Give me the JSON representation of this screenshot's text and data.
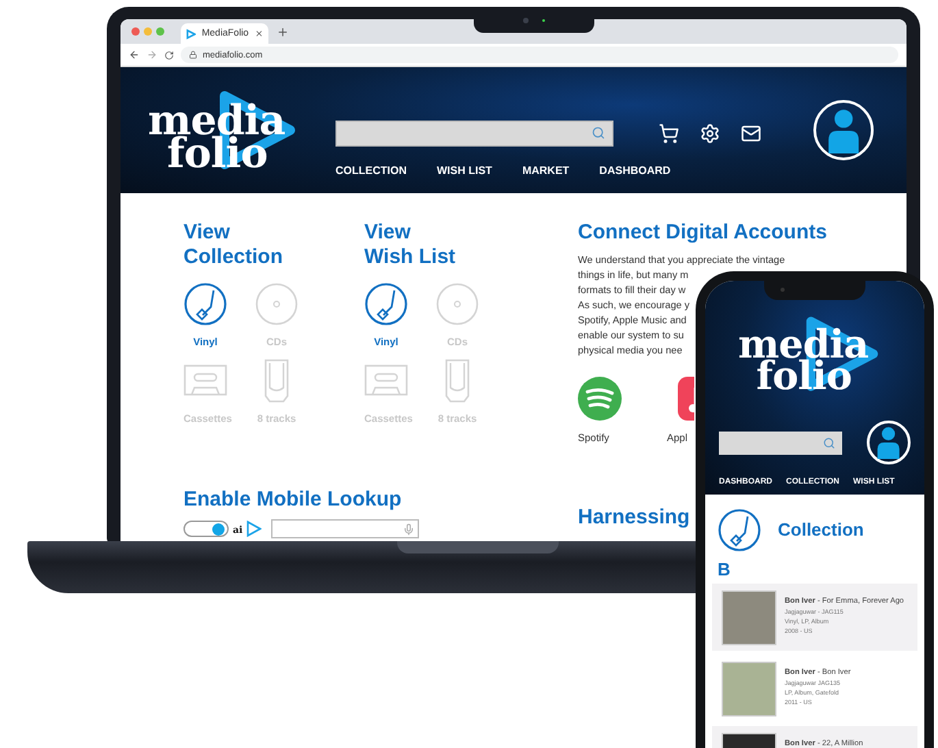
{
  "laptop": {
    "browser": {
      "tab_title": "MediaFolio",
      "url": "mediafolio.com"
    },
    "header": {
      "logo": {
        "line1": "media",
        "line2": "folio"
      },
      "nav": [
        "COLLECTION",
        "WISH LIST",
        "MARKET",
        "DASHBOARD"
      ]
    },
    "sections": [
      {
        "title_lines": [
          "View",
          "Collection"
        ],
        "formats": [
          {
            "label": "Vinyl",
            "kind": "vinyl",
            "selected": true
          },
          {
            "label": "CDs",
            "kind": "cd",
            "selected": false
          },
          {
            "label": "Cassettes",
            "kind": "cassette",
            "selected": false
          },
          {
            "label": "8 tracks",
            "kind": "eight-track",
            "selected": false
          }
        ]
      },
      {
        "title_lines": [
          "View",
          "Wish List"
        ],
        "formats": [
          {
            "label": "Vinyl",
            "kind": "vinyl",
            "selected": true
          },
          {
            "label": "CDs",
            "kind": "cd",
            "selected": false
          },
          {
            "label": "Cassettes",
            "kind": "cassette",
            "selected": false
          },
          {
            "label": "8 tracks",
            "kind": "eight-track",
            "selected": false
          }
        ]
      }
    ],
    "mobile_lookup": {
      "title": "Enable Mobile Lookup",
      "on": true,
      "ai_label": "ai"
    },
    "connect": {
      "title": "Connect Digital Accounts",
      "paragraph_lines": [
        "We understand that you appreciate the vintage",
        "things in life, but many m",
        "formats to fill their day w",
        "As such, we encourage y",
        "Spotify, Apple Music and",
        "enable our system to su",
        "physical media you nee"
      ],
      "services": [
        {
          "label": "Spotify",
          "kind": "spotify"
        },
        {
          "label": "Appl",
          "kind": "apple"
        }
      ]
    },
    "harnessing_title": "Harnessing"
  },
  "phone": {
    "header": {
      "logo": {
        "line1": "media",
        "line2": "folio"
      },
      "nav": [
        "DASHBOARD",
        "COLLECTION",
        "WISH LIST"
      ]
    },
    "collection_title": "Collection",
    "letter": "B",
    "records": [
      {
        "line": "**Bon Iver** - For Emma, Forever Ago",
        "details": [
          "Jagjaguwar - JAG115",
          "Vinyl, LP, Album",
          "2008 - US"
        ],
        "shaded": true
      },
      {
        "line": "**Bon Iver** - Bon Iver",
        "details": [
          "Jagjaguwar JAG135",
          "LP, Album, Gatefold",
          "2011 - US"
        ],
        "shaded": false
      },
      {
        "line": "**Bon Iver** - 22, A Million",
        "shaded": true
      }
    ]
  }
}
